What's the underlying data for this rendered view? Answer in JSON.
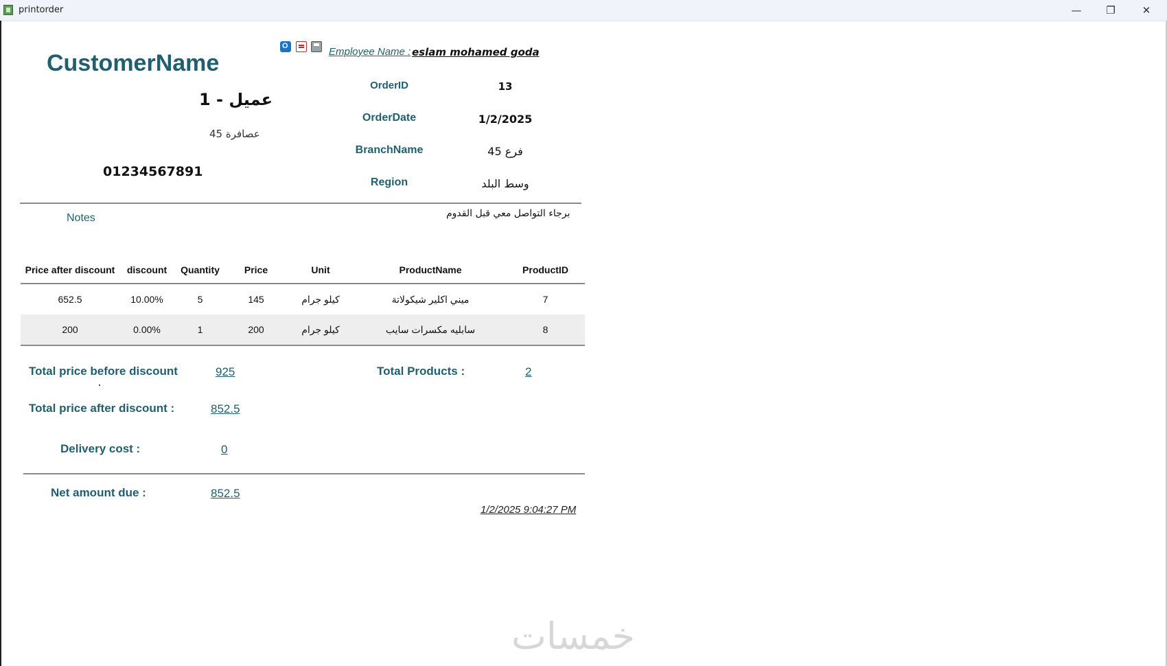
{
  "window": {
    "title": "printorder",
    "minimize": "—",
    "restore": "❐",
    "close": "✕"
  },
  "customer": {
    "title": "CustomerName",
    "name": "عميل - 1",
    "address": "عصافرة 45",
    "phone": "01234567891"
  },
  "toolbar": {
    "icons": [
      "outlook-icon",
      "pdf-icon",
      "print-icon"
    ]
  },
  "employee": {
    "label": "Employee Name :",
    "value": "eslam mohamed goda"
  },
  "order": {
    "id_label": "OrderID",
    "id_value": "13",
    "date_label": "OrderDate",
    "date_value": "1/2/2025",
    "branch_label": "BranchName",
    "branch_value": "فرع 45",
    "region_label": "Region",
    "region_value": "وسط البلد"
  },
  "notes": {
    "label": "Notes",
    "value": "برجاء التواصل معي قبل القدوم"
  },
  "table": {
    "headers": [
      "Price after discount",
      "discount",
      "Quantity",
      "Price",
      "Unit",
      "ProductName",
      "ProductID"
    ],
    "rows": [
      [
        "652.5",
        "10.00%",
        "5",
        "145",
        "كيلو جرام",
        "ميني اكلير شيكولاتة",
        "7"
      ],
      [
        "200",
        "0.00%",
        "1",
        "200",
        "كيلو جرام",
        "سابليه مكسرات سايب",
        "8"
      ]
    ]
  },
  "summary": {
    "before_label": "Total price before discount",
    "before_value": "925",
    "after_label": "Total price after discount :",
    "after_value": "852.5",
    "delivery_label": "Delivery cost :",
    "delivery_value": "0",
    "products_label": "Total Products :",
    "products_value": "2",
    "net_label": "Net amount due :",
    "net_value": "852.5",
    "timestamp": "1/2/2025 9:04:27 PM"
  },
  "watermark": "خمسات"
}
